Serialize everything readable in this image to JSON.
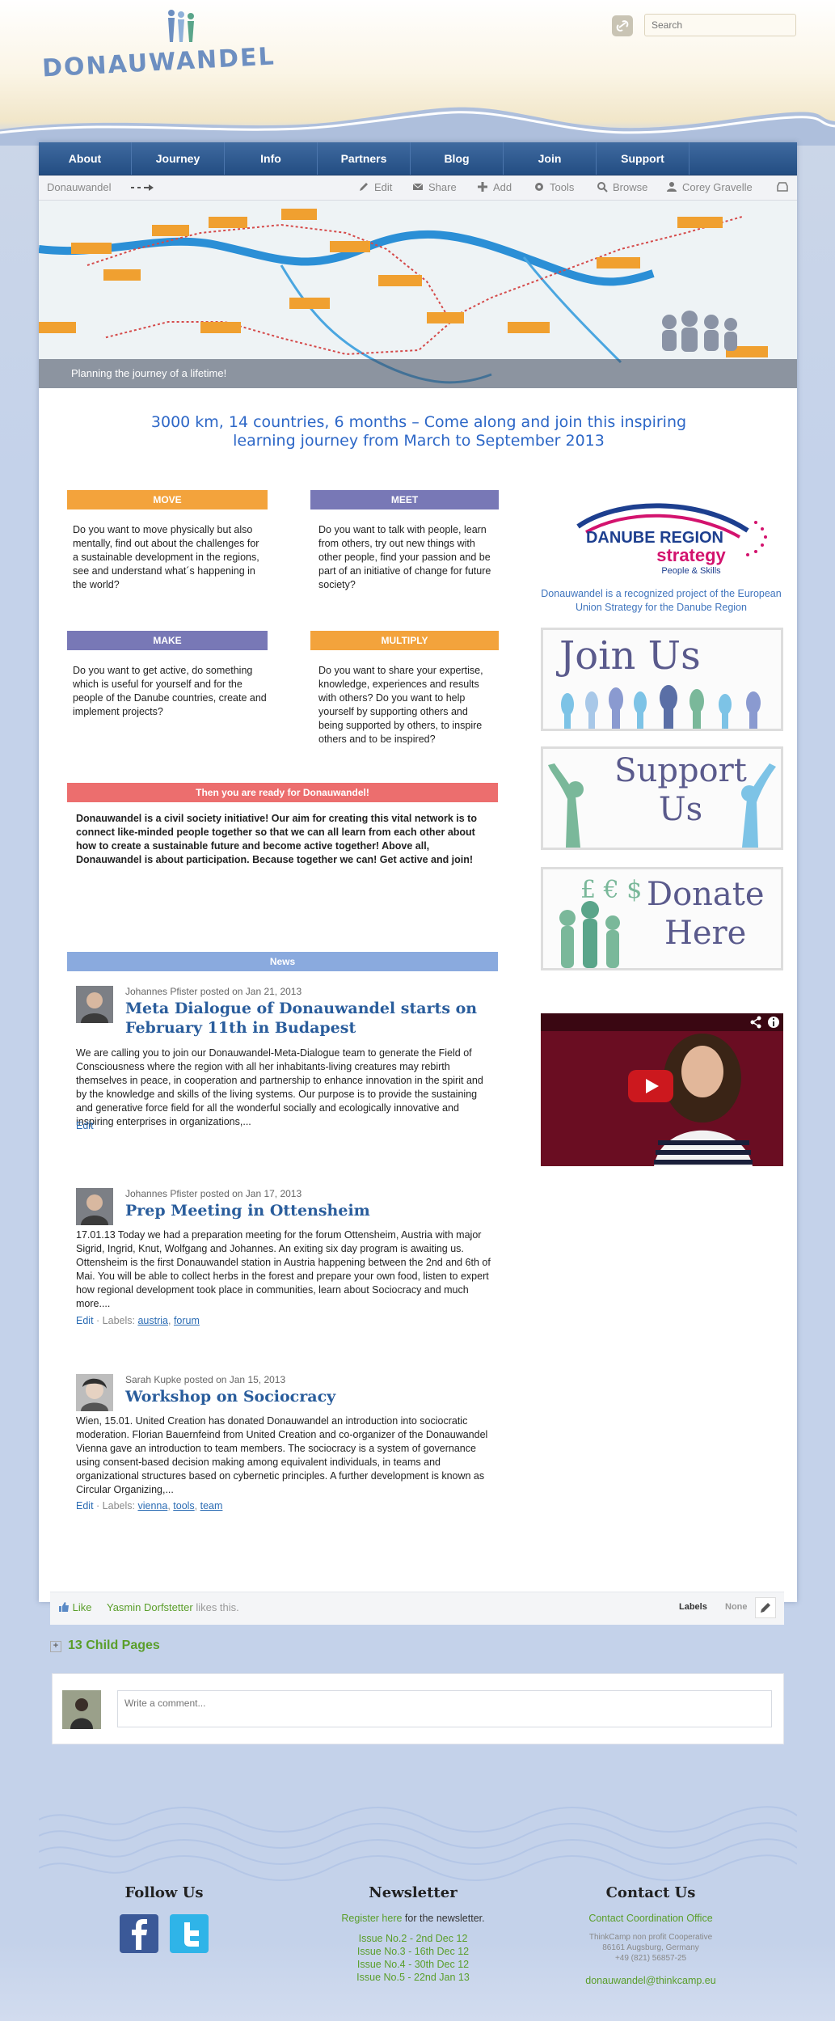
{
  "header": {
    "logo_text": "DONAUWANDEL",
    "search_placeholder": "Search"
  },
  "nav": {
    "items": [
      {
        "label": "About"
      },
      {
        "label": "Journey"
      },
      {
        "label": "Info"
      },
      {
        "label": "Partners"
      },
      {
        "label": "Blog"
      },
      {
        "label": "Join"
      },
      {
        "label": "Support"
      }
    ]
  },
  "toolbar": {
    "breadcrumb": "Donauwandel",
    "edit": "Edit",
    "share": "Share",
    "add": "Add",
    "tools": "Tools",
    "browse": "Browse",
    "user": "Corey Gravelle"
  },
  "banner": {
    "caption": "Planning the journey of a lifetime!"
  },
  "headline": "3000 km, 14 countries, 6 months – Come along and join this inspiring learning journey from March to September 2013",
  "boxes": {
    "move": {
      "title": "MOVE",
      "text": " Do you want to move physically but also mentally, find out about the challenges for a sustainable development in the regions, see and understand what´s happening in the world?"
    },
    "meet": {
      "title": "MEET",
      "text": " Do you want to talk with people, learn from others, try out new things with other people, find your passion and be part of an initiative of change for future society?"
    },
    "make": {
      "title": "MAKE",
      "text": " Do you want to get active, do something which is useful for yourself and for the people of the Danube countries, create and implement projects?"
    },
    "multiply": {
      "title": "MULTIPLY",
      "text": "Do you want to share your expertise, knowledge, experiences and results with others? Do you want to help yourself by supporting others and being supported by others, to inspire others and to be inspired?"
    }
  },
  "ready": {
    "title": "Then you are ready for Donauwandel!",
    "text": "Donauwandel is a civil society initiative! Our aim for creating this vital network is to connect like-minded people together so that we can all learn from each other about how to create a sustainable future and become active together! Above all, Donauwandel is about participation. Because together we can! Get active and join!"
  },
  "news": {
    "title": "News",
    "posts": [
      {
        "meta": "Johannes Pfister posted on Jan 21, 2013",
        "title": "Meta Dialogue of Donauwandel starts on February 11th in Budapest",
        "body": "We are calling you to join our Donauwandel-Meta-Dialogue team to generate the Field of Consciousness where the region with all her inhabitants-living creatures may rebirth themselves in peace, in cooperation and partnership to enhance innovation in the spirit and by the knowledge and skills of the living systems. Our purpose is to provide the sustaining and generative force field for all the wonderful socially and ecologically innovative and inspiring enterprises in organizations,...",
        "edit": "Edit"
      },
      {
        "meta": "Johannes Pfister posted on Jan 17, 2013",
        "title": "Prep Meeting in Ottensheim",
        "body": "17.01.13 Today we had a preparation meeting for the forum Ottensheim, Austria with major Sigrid, Ingrid, Knut, Wolfgang and Johannes. An exiting six day program is awaiting us. Ottensheim is the first Donauwandel station in Austria happening between the 2nd and 6th of Mai. You will be able to collect herbs in the forest and prepare your own food, listen to expert how regional development took place in communities, learn about Sociocracy and much more....",
        "edit": "Edit",
        "labels_prefix": "· Labels:",
        "labels": [
          "austria",
          "forum"
        ]
      },
      {
        "meta": "Sarah Kupke posted on Jan 15, 2013",
        "title": "Workshop on Sociocracy",
        "body": " Wien, 15.01. United Creation has donated Donauwandel an introduction into sociocratic moderation. Florian Bauernfeind from United Creation and co-organizer of the Donauwandel Vienna gave an introduction to team members. The sociocracy is a system of governance using consent-based decision making among equivalent individuals, in teams and organizational structures based on cybernetic principles. A further development is known as Circular Organizing,...",
        "edit": "Edit",
        "labels_prefix": "· Labels:",
        "labels": [
          "vienna",
          "tools",
          "team"
        ]
      }
    ]
  },
  "sidebar": {
    "drs_title": "DANUBE REGION",
    "drs_strategy": "strategy",
    "drs_sub": "People & Skills",
    "drs_caption": "Donauwandel is a recognized project of the European Union Strategy for the Danube Region",
    "join": "Join Us",
    "support_1": "Support",
    "support_2": "Us",
    "donate_1": "Donate",
    "donate_2": "Here",
    "donate_symbols": "£ €  $"
  },
  "likebar": {
    "like": "Like",
    "liker": "Yasmin Dorfstetter",
    "likes_suffix": "likes this.",
    "labels_title": "Labels",
    "labels_value": "None"
  },
  "child_pages": "13 Child Pages",
  "comment": {
    "placeholder": "Write a comment..."
  },
  "footer": {
    "follow_title": "Follow Us",
    "newsletter_title": "Newsletter",
    "register_link": "Register here",
    "register_suffix": "for the newsletter.",
    "issues": [
      "Issue No.2 - 2nd Dec 12",
      "Issue No.3 - 16th Dec 12",
      "Issue No.4 - 30th Dec 12",
      "Issue No.5 - 22nd Jan 13"
    ],
    "contact_title": "Contact Us",
    "contact_office": "Contact Coordination Office",
    "address_1": "ThinkCamp non profit Cooperative",
    "address_2": "86161 Augsburg, Germany",
    "address_3": "+49 (821) 56857-25",
    "email": "donauwandel@thinkcamp.eu"
  },
  "colors": {
    "nav_blue": "#2b5a92",
    "orange": "#f3a33c",
    "purple": "#7878b6",
    "red": "#ec6e6e",
    "news_blue": "#8aaade",
    "headline_blue": "#2d67c7",
    "link_green": "#5a9e2a"
  }
}
